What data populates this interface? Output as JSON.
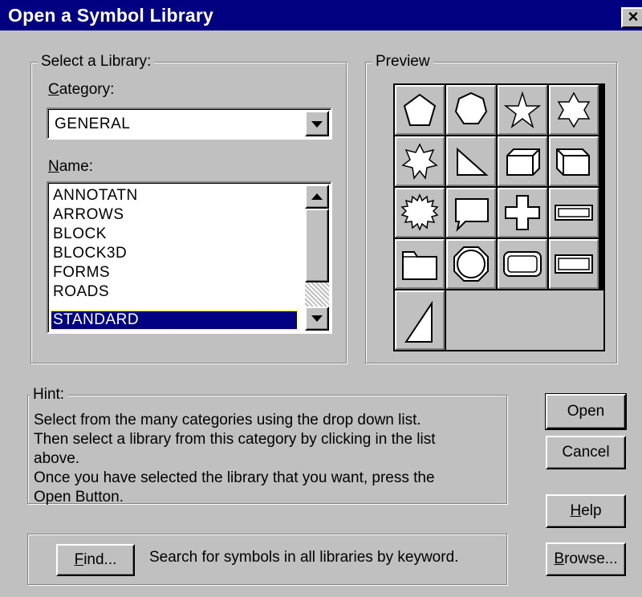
{
  "window": {
    "title": "Open a Symbol Library",
    "close_label": "×"
  },
  "select_group": {
    "legend": "Select a Library:",
    "category_label_accel": "C",
    "category_label_rest": "ategory:",
    "category_value": "GENERAL",
    "name_label_accel": "N",
    "name_label_rest": "ame:",
    "names": [
      "ANNOTATN",
      "ARROWS",
      "BLOCK",
      "BLOCK3D",
      "FORMS",
      "ROADS",
      "STANDARD"
    ],
    "selected_name": "STANDARD"
  },
  "preview_group": {
    "legend": "Preview",
    "symbols": [
      "pentagon-icon",
      "heptagon-icon",
      "five-point-star-icon",
      "six-point-star-icon",
      "seven-point-star-icon",
      "right-triangle-icon",
      "box-3d-icon",
      "box-3d-left-icon",
      "starburst-icon",
      "speech-balloon-icon",
      "cross-icon",
      "double-rectangle-icon",
      "folder-icon",
      "octagon-circle-icon",
      "rounded-rectangle-icon",
      "beveled-rectangle-icon",
      "triangle-icon"
    ]
  },
  "hint_group": {
    "legend": "Hint:",
    "lines": [
      "Select from the many categories using the drop down list.",
      "Then select a library from this category by clicking in the list",
      "above.",
      "Once you have selected the library that you want, press the",
      "Open Button."
    ]
  },
  "find_group": {
    "find_label_accel": "F",
    "find_label_rest": "ind...",
    "description": "Search for symbols in all libraries by keyword."
  },
  "buttons": {
    "open": "Open",
    "cancel": "Cancel",
    "help_accel": "H",
    "help_rest": "elp",
    "browse_accel": "B",
    "browse_rest": "rowse..."
  }
}
